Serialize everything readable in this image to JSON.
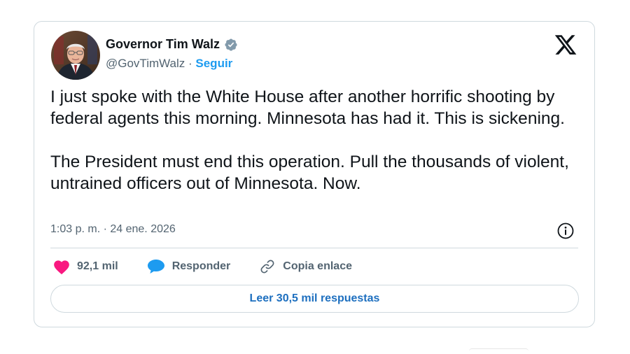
{
  "author": {
    "name": "Governor Tim Walz",
    "handle": "@GovTimWalz",
    "separator": " · ",
    "follow_label": "Seguir",
    "verified": true,
    "verified_color": "#829aab"
  },
  "icons": {
    "brand": "x-logo-icon",
    "verified": "verified-badge-icon",
    "info": "info-icon",
    "like": "heart-icon",
    "reply": "speech-bubble-icon",
    "copy_link": "link-icon"
  },
  "tweet": {
    "paragraphs": [
      "I just spoke with the White House after another horrific shooting by federal agents this morning. Minnesota has had it. This is sickening.",
      "The President must end this operation. Pull the thousands of violent, untrained officers out of Minnesota. Now."
    ],
    "timestamp": "1:03 p. m. · 24 ene. 2026"
  },
  "actions": {
    "likes": "92,1 mil",
    "reply_label": "Responder",
    "copy_link_label": "Copia enlace"
  },
  "read_replies_label": "Leer 30,5 mil respuestas",
  "colors": {
    "like": "#f91880",
    "reply": "#1d9bf0",
    "link_accent": "#1d9bf0",
    "border": "#cfd9de",
    "secondary_text": "#536471"
  }
}
